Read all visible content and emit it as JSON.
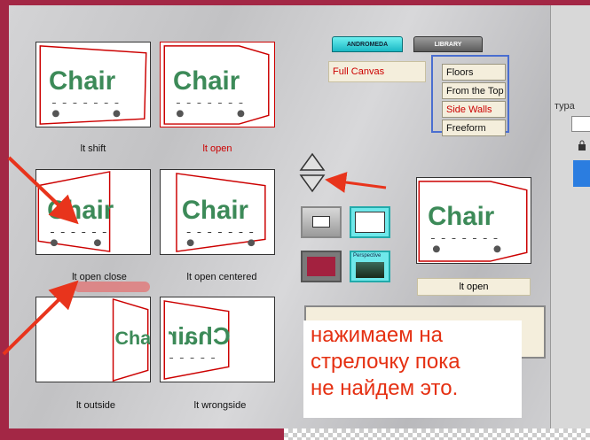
{
  "thumbnails": [
    {
      "label": "lt shift",
      "selected": false
    },
    {
      "label": "lt open",
      "selected": true
    },
    {
      "label": "lt open close",
      "selected": false
    },
    {
      "label": "lt open centered",
      "selected": false
    },
    {
      "label": "lt outside",
      "selected": false
    },
    {
      "label": "lt wrongside",
      "selected": false
    }
  ],
  "thumb_text": "Chair",
  "tabs": {
    "andromeda": "ANDROMEDA",
    "library": "LIBRARY"
  },
  "full_canvas": "Full Canvas",
  "menu": [
    "Floors",
    "From the Top",
    "Side Walls",
    "Freeform"
  ],
  "swatches": {
    "perspective_label": "Perspective"
  },
  "preview_label": "lt open",
  "caption_lines": [
    "нажимаем на",
    "стрелочку пока",
    "не найдем это."
  ],
  "right_panel_text": "тура",
  "colors": {
    "frame": "#a32745",
    "accent_red": "#c00000",
    "caption_red": "#e53012",
    "chair_green": "#3c8a58"
  }
}
